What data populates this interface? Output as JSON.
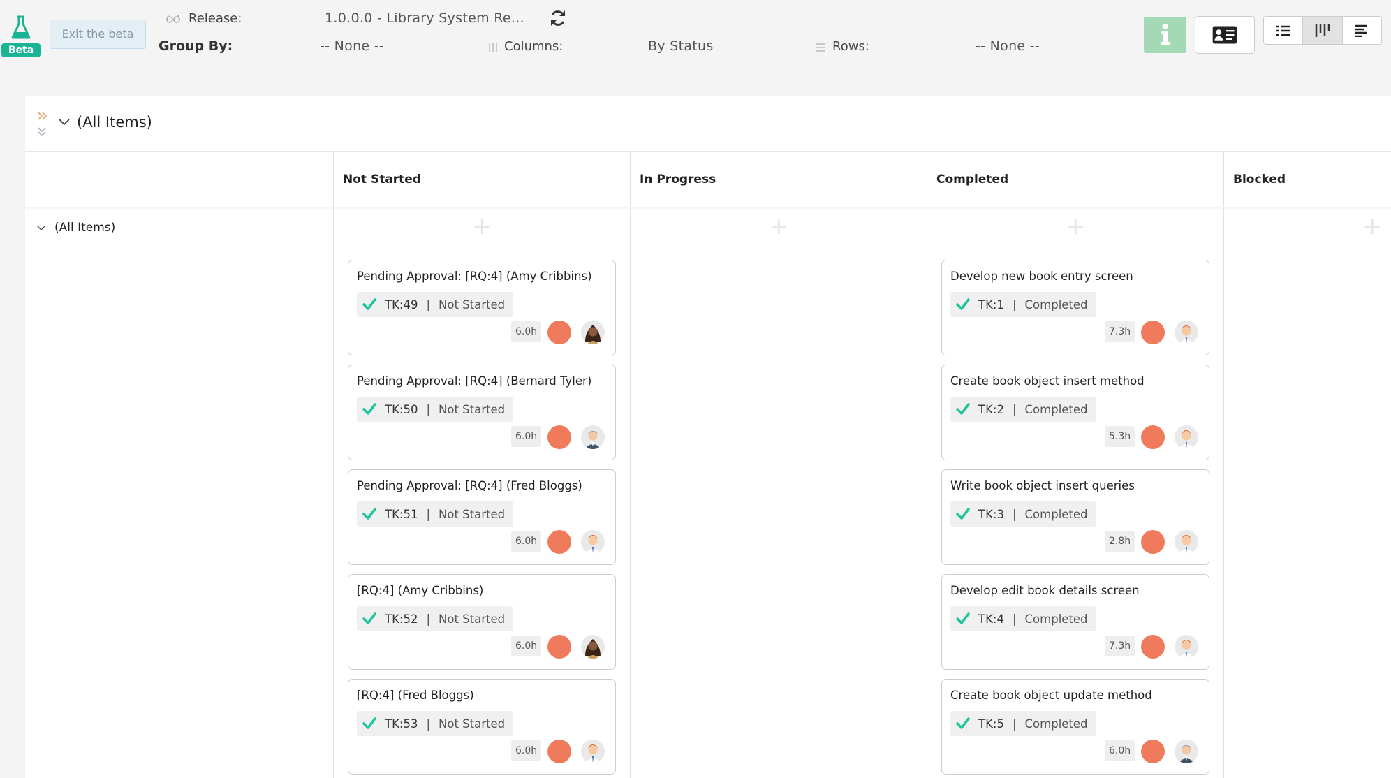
{
  "beta": {
    "badge_label": "Beta",
    "exit_label": "Exit the beta"
  },
  "toolbar": {
    "release_label": "Release:",
    "release_value": "1.0.0.0 - Library System Re...",
    "group_by_label": "Group By:",
    "group_by_value": "-- None --",
    "columns_label": "Columns:",
    "columns_value": "By Status",
    "rows_label": "Rows:",
    "rows_value": "-- None --"
  },
  "board": {
    "header_title": "(All Items)",
    "row_label": "(All Items)",
    "columns": [
      {
        "label": "Not Started"
      },
      {
        "label": "In Progress"
      },
      {
        "label": "Completed"
      },
      {
        "label": "Blocked"
      }
    ]
  },
  "cards": {
    "not_started": [
      {
        "title": "Pending Approval: [RQ:4] (Amy Cribbins)",
        "id": "TK:49",
        "status": "Not Started",
        "hours": "6.0h",
        "avatar": "female-dark-avatar"
      },
      {
        "title": "Pending Approval: [RQ:4] (Bernard Tyler)",
        "id": "TK:50",
        "status": "Not Started",
        "hours": "6.0h",
        "avatar": "male-grey-avatar"
      },
      {
        "title": "Pending Approval: [RQ:4] (Fred Bloggs)",
        "id": "TK:51",
        "status": "Not Started",
        "hours": "6.0h",
        "avatar": "male-redhead-avatar"
      },
      {
        "title": "[RQ:4] (Amy Cribbins)",
        "id": "TK:52",
        "status": "Not Started",
        "hours": "6.0h",
        "avatar": "female-dark-avatar"
      },
      {
        "title": "[RQ:4] (Fred Bloggs)",
        "id": "TK:53",
        "status": "Not Started",
        "hours": "6.0h",
        "avatar": "male-redhead-avatar"
      }
    ],
    "completed": [
      {
        "title": "Develop new book entry screen",
        "id": "TK:1",
        "status": "Completed",
        "hours": "7.3h",
        "avatar": "male-redhead-avatar"
      },
      {
        "title": "Create book object insert method",
        "id": "TK:2",
        "status": "Completed",
        "hours": "5.3h",
        "avatar": "male-redhead-avatar"
      },
      {
        "title": "Write book object insert queries",
        "id": "TK:3",
        "status": "Completed",
        "hours": "2.8h",
        "avatar": "male-redhead-avatar"
      },
      {
        "title": "Develop edit book details screen",
        "id": "TK:4",
        "status": "Completed",
        "hours": "7.3h",
        "avatar": "male-redhead-avatar"
      },
      {
        "title": "Create book object update method",
        "id": "TK:5",
        "status": "Completed",
        "hours": "6.0h",
        "avatar": "male-grey-avatar"
      }
    ]
  },
  "colors": {
    "accent_green": "#1ab394",
    "check_green": "#1dc49c",
    "priority_dot": "#f07b5c",
    "info_button": "#a4d9b5"
  }
}
